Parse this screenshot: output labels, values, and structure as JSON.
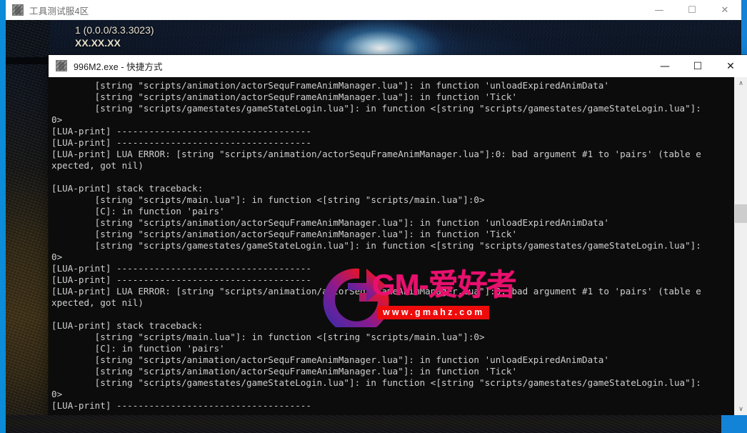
{
  "desktop": {
    "accent_color": "#0b8bd8"
  },
  "game_window": {
    "title": "工具测试服4区",
    "icon": "app-icon",
    "controls": {
      "minimize": "—",
      "maximize": "☐",
      "close": "✕"
    },
    "hud": {
      "line1": "1 (0.0.0/3.3.3023)",
      "line2": "XX.XX.XX"
    }
  },
  "console_window": {
    "title": "996M2.exe - 快捷方式",
    "icon": "app-icon",
    "controls": {
      "minimize": "—",
      "maximize": "☐",
      "close": "✕"
    },
    "scrollbar": {
      "up_arrow": "∧",
      "down_arrow": "∨",
      "thumb_position_pct": 45
    },
    "output": "        [string \"scripts/animation/actorSequFrameAnimManager.lua\"]: in function 'unloadExpiredAnimData'\n        [string \"scripts/animation/actorSequFrameAnimManager.lua\"]: in function 'Tick'\n        [string \"scripts/gamestates/gameStateLogin.lua\"]: in function <[string \"scripts/gamestates/gameStateLogin.lua\"]:\n0>\n[LUA-print] ------------------------------------\n[LUA-print] ------------------------------------\n[LUA-print] LUA ERROR: [string \"scripts/animation/actorSequFrameAnimManager.lua\"]:0: bad argument #1 to 'pairs' (table e\nxpected, got nil)\n\n[LUA-print] stack traceback:\n        [string \"scripts/main.lua\"]: in function <[string \"scripts/main.lua\"]:0>\n        [C]: in function 'pairs'\n        [string \"scripts/animation/actorSequFrameAnimManager.lua\"]: in function 'unloadExpiredAnimData'\n        [string \"scripts/animation/actorSequFrameAnimManager.lua\"]: in function 'Tick'\n        [string \"scripts/gamestates/gameStateLogin.lua\"]: in function <[string \"scripts/gamestates/gameStateLogin.lua\"]:\n0>\n[LUA-print] ------------------------------------\n[LUA-print] ------------------------------------\n[LUA-print] LUA ERROR: [string \"scripts/animation/actorSequFrameAnimManager.lua\"]:0: bad argument #1 to 'pairs' (table e\nxpected, got nil)\n\n[LUA-print] stack traceback:\n        [string \"scripts/main.lua\"]: in function <[string \"scripts/main.lua\"]:0>\n        [C]: in function 'pairs'\n        [string \"scripts/animation/actorSequFrameAnimManager.lua\"]: in function 'unloadExpiredAnimData'\n        [string \"scripts/animation/actorSequFrameAnimManager.lua\"]: in function 'Tick'\n        [string \"scripts/gamestates/gameStateLogin.lua\"]: in function <[string \"scripts/gamestates/gameStateLogin.lua\"]:\n0>\n[LUA-print] ------------------------------------\n"
  },
  "watermark": {
    "brand": "GM-爱好者",
    "url": "www.gmahz.com",
    "brand_color": "#e8106e",
    "url_bg_color": "#ee0b0b",
    "logo": "g-arrow-logo"
  }
}
